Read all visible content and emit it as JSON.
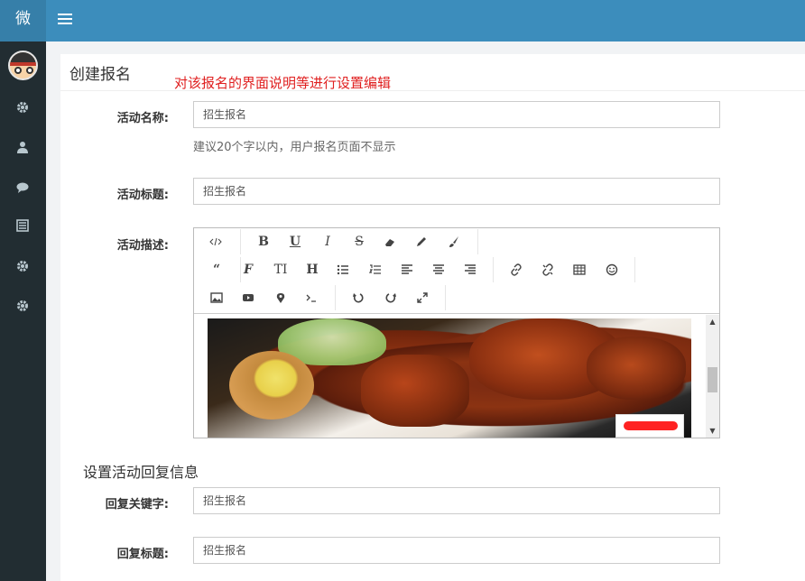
{
  "header": {
    "logo_text": "微",
    "menu_toggle_icon": "hamburger-icon",
    "bg_color": "#3c8dbc",
    "sidebar_color": "#222d32"
  },
  "sidebar": {
    "items": [
      {
        "icon": "avatar"
      },
      {
        "icon": "gear-icon"
      },
      {
        "icon": "user-icon"
      },
      {
        "icon": "comment-icon"
      },
      {
        "icon": "list-icon"
      },
      {
        "icon": "gear-icon"
      },
      {
        "icon": "gear-icon"
      }
    ]
  },
  "page": {
    "title": "创建报名",
    "annotation": "对该报名的界面说明等进行设置编辑",
    "annotation_color": "#e02020"
  },
  "form": {
    "name": {
      "label": "活动名称:",
      "value": "招生报名",
      "help": "建议20个字以内，用户报名页面不显示"
    },
    "title": {
      "label": "活动标题:",
      "value": "招生报名"
    },
    "description": {
      "label": "活动描述:"
    }
  },
  "editor": {
    "toolbar_rows": [
      [
        "code-view",
        "bold",
        "underline",
        "italic",
        "strikethrough",
        "eraser",
        "pencil",
        "paintbrush"
      ],
      [
        "quote",
        "font-family",
        "font-size",
        "heading",
        "unordered-list",
        "ordered-list",
        "align-left",
        "align-center",
        "align-right",
        "link",
        "unlink",
        "table",
        "emoticon"
      ],
      [
        "image",
        "video",
        "map-marker",
        "terminal",
        "undo",
        "redo",
        "fullscreen"
      ]
    ],
    "content_image": "braised-pork-with-egg-photo"
  },
  "reply": {
    "section_title": "设置活动回复信息",
    "keyword": {
      "label": "回复关键字:",
      "value": "招生报名"
    },
    "title": {
      "label": "回复标题:",
      "value": "招生报名"
    }
  }
}
